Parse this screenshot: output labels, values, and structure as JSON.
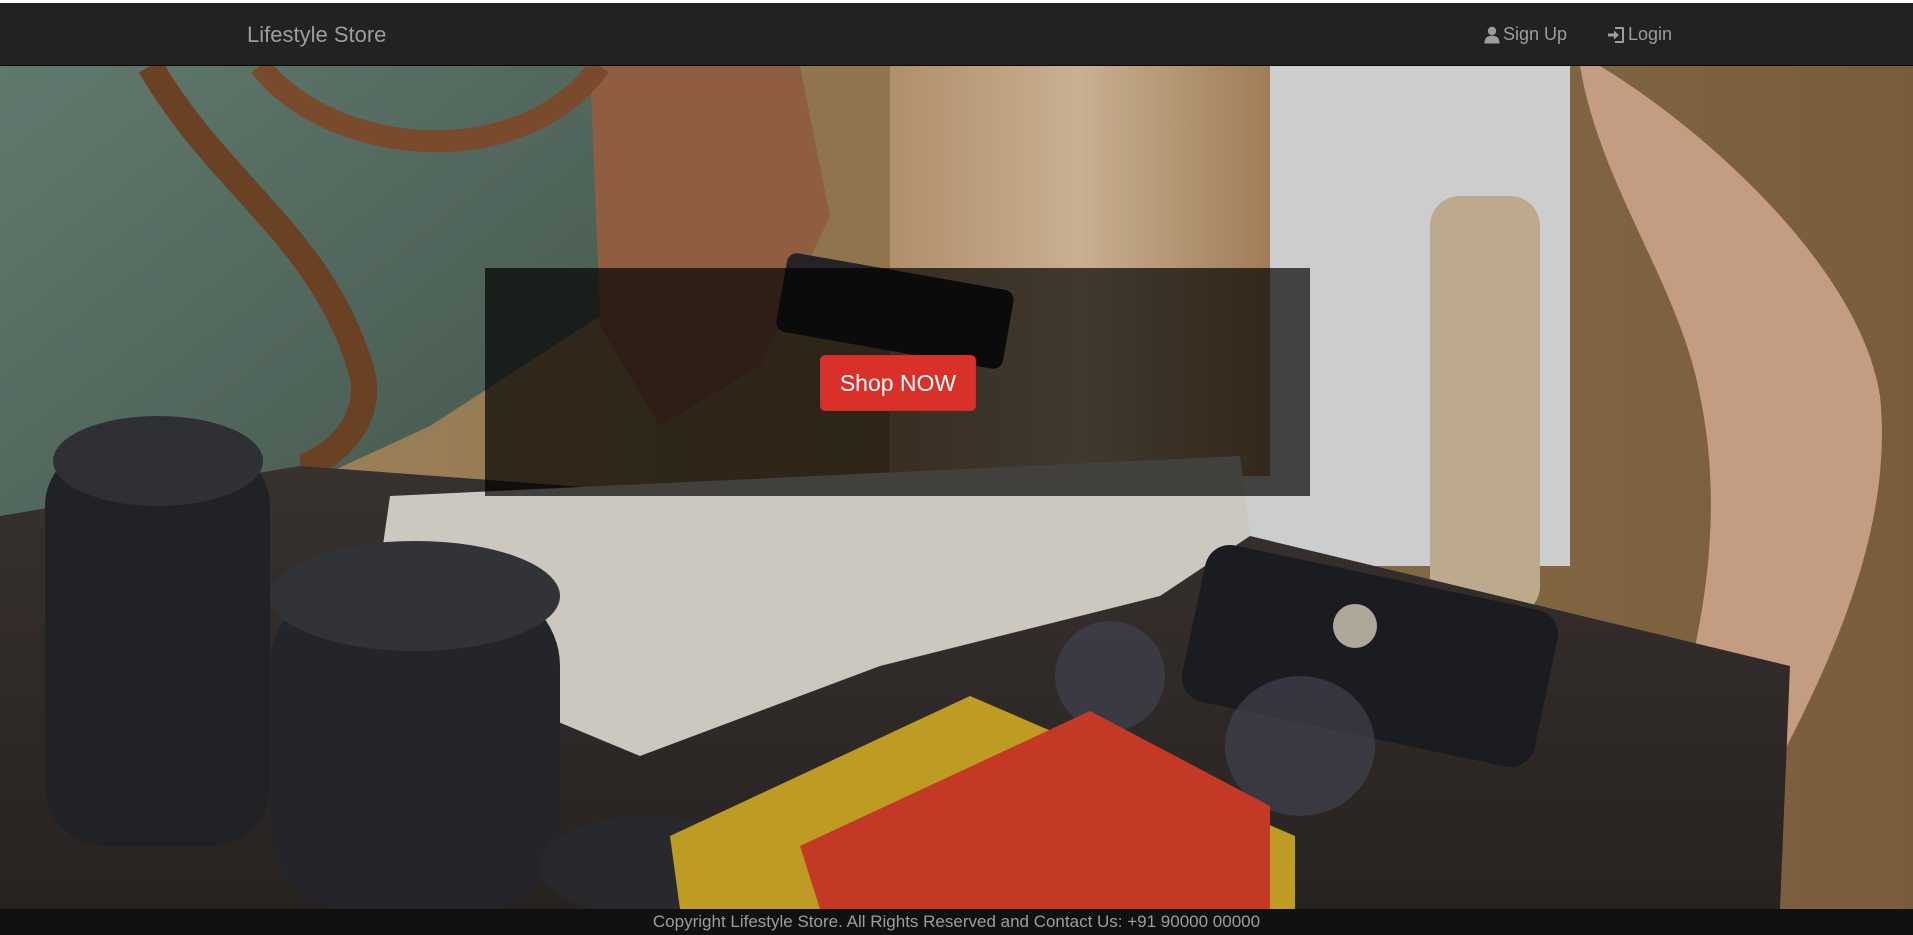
{
  "navbar": {
    "brand": "Lifestyle Store",
    "links": [
      {
        "label": "Sign Up",
        "icon": "user-icon"
      },
      {
        "label": "Login",
        "icon": "log-in-icon"
      }
    ]
  },
  "hero": {
    "button_label": "Shop NOW",
    "button_color": "#d9302a"
  },
  "footer": {
    "text": "Copyright Lifestyle Store. All Rights Reserved and Contact Us: +91 90000 00000"
  }
}
